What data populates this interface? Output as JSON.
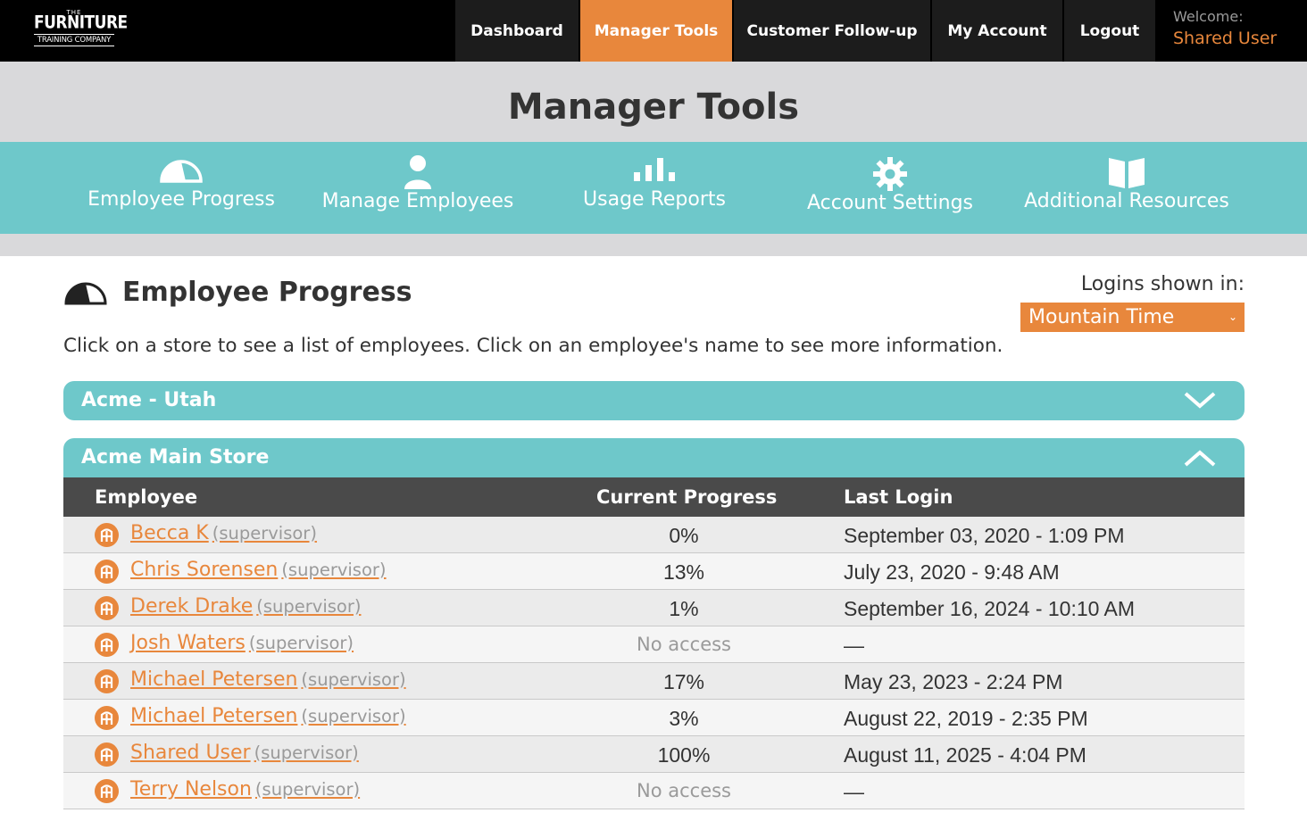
{
  "brand": {
    "line1": "THE",
    "line2": "FURNITURE",
    "line3": "TRAINING COMPANY"
  },
  "nav": {
    "items": [
      {
        "label": "Dashboard"
      },
      {
        "label": "Manager Tools"
      },
      {
        "label": "Customer Follow-up"
      },
      {
        "label": "My Account"
      },
      {
        "label": "Logout"
      }
    ],
    "active": "Manager Tools",
    "welcome_label": "Welcome:",
    "welcome_user": "Shared User"
  },
  "page_title": "Manager Tools",
  "tools": [
    {
      "label": "Employee Progress",
      "icon": "gauge-icon"
    },
    {
      "label": "Manage Employees",
      "icon": "person-icon"
    },
    {
      "label": "Usage Reports",
      "icon": "bar-chart-icon"
    },
    {
      "label": "Account Settings",
      "icon": "gear-icon"
    },
    {
      "label": "Additional Resources",
      "icon": "book-icon"
    }
  ],
  "section": {
    "title": "Employee Progress",
    "intro": "Click on a store to see a list of employees. Click on an employee's name to see more information.",
    "logins_label": "Logins shown in:",
    "timezone": "Mountain Time"
  },
  "stores": [
    {
      "name": "Acme - Utah",
      "expanded": false
    },
    {
      "name": "Acme Main Store",
      "expanded": true
    }
  ],
  "table": {
    "headers": {
      "employee": "Employee",
      "progress": "Current Progress",
      "login": "Last Login"
    },
    "rows": [
      {
        "name": "Becca K",
        "role": "(supervisor)",
        "progress": "0%",
        "login": "September 03, 2020 - 1:09 PM"
      },
      {
        "name": "Chris Sorensen",
        "role": "(supervisor)",
        "progress": "13%",
        "login": "July 23, 2020 - 9:48 AM"
      },
      {
        "name": "Derek Drake",
        "role": "(supervisor)",
        "progress": "1%",
        "login": "September 16, 2024 - 10:10 AM"
      },
      {
        "name": "Josh Waters",
        "role": "(supervisor)",
        "progress": "No access",
        "login": "—"
      },
      {
        "name": "Michael Petersen",
        "role": "(supervisor)",
        "progress": "17%",
        "login": "May 23, 2023 - 2:24 PM"
      },
      {
        "name": "Michael Petersen",
        "role": "(supervisor)",
        "progress": "3%",
        "login": "August 22, 2019 - 2:35 PM"
      },
      {
        "name": "Shared User",
        "role": "(supervisor)",
        "progress": "100%",
        "login": "August 11, 2025 - 4:04 PM"
      },
      {
        "name": "Terry Nelson",
        "role": "(supervisor)",
        "progress": "No access",
        "login": "—"
      }
    ]
  },
  "colors": {
    "accent": "#e8873c",
    "teal": "#6ec8ca",
    "header_bg": "#4a4a4a"
  }
}
